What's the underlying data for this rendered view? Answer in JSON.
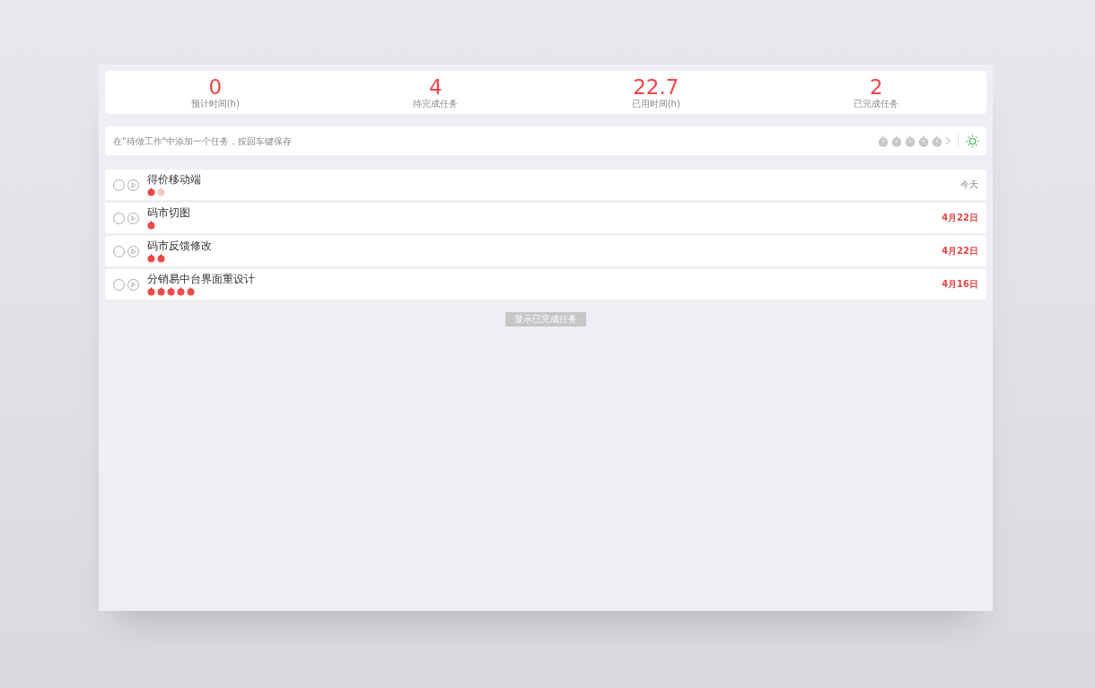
{
  "stats": [
    {
      "value": "0",
      "label": "预计时间(h)"
    },
    {
      "value": "4",
      "label": "待完成任务"
    },
    {
      "value": "22.7",
      "label": "已用时间(h)"
    },
    {
      "value": "2",
      "label": "已完成任务"
    }
  ],
  "new_task": {
    "placeholder": "在\"待做工作\"中添加一个任务，按回车键保存",
    "estimate": [
      {
        "selected": false
      },
      {
        "selected": false
      },
      {
        "selected": false
      },
      {
        "selected": false
      },
      {
        "selected": false
      }
    ]
  },
  "tasks": [
    {
      "title": "得价移动端",
      "checked": false,
      "pomodoros": [
        {
          "done": true
        },
        {
          "done": false
        }
      ],
      "due": "今天",
      "overdue": false
    },
    {
      "title": "码市切图",
      "checked": false,
      "pomodoros": [
        {
          "done": true
        }
      ],
      "due": "4月22日",
      "overdue": true
    },
    {
      "title": "码市反馈修改",
      "checked": false,
      "pomodoros": [
        {
          "done": true
        },
        {
          "done": true
        }
      ],
      "due": "4月22日",
      "overdue": true
    },
    {
      "title": "分销易中台界面重设计",
      "checked": false,
      "pomodoros": [
        {
          "done": true
        },
        {
          "done": true
        },
        {
          "done": true
        },
        {
          "done": true
        },
        {
          "done": true
        }
      ],
      "due": "4月16日",
      "overdue": true
    }
  ],
  "show_completed": "显示已完成任务"
}
